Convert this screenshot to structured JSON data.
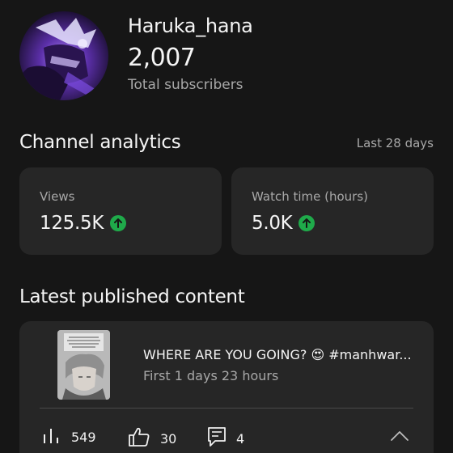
{
  "channel": {
    "name": "Haruka_hana",
    "subscribers": "2,007",
    "subscribers_label": "Total subscribers",
    "avatar_icon": "anime-character-avatar"
  },
  "analytics": {
    "title": "Channel analytics",
    "period": "Last 28 days",
    "cards": [
      {
        "label": "Views",
        "value": "125.5K",
        "trend_icon": "arrow-up-icon"
      },
      {
        "label": "Watch time (hours)",
        "value": "5.0K",
        "trend_icon": "arrow-up-icon"
      }
    ]
  },
  "latest": {
    "title": "Latest published content",
    "video": {
      "title": "WHERE ARE YOU GOING? 😍 #manhwar...",
      "age": "First 1 days 23 hours",
      "views": "549",
      "likes": "30",
      "comments": "4"
    }
  },
  "colors": {
    "background": "#161616",
    "card": "#262626",
    "accent_up": "#1faa4a",
    "secondary_text": "#a8a8a8"
  }
}
